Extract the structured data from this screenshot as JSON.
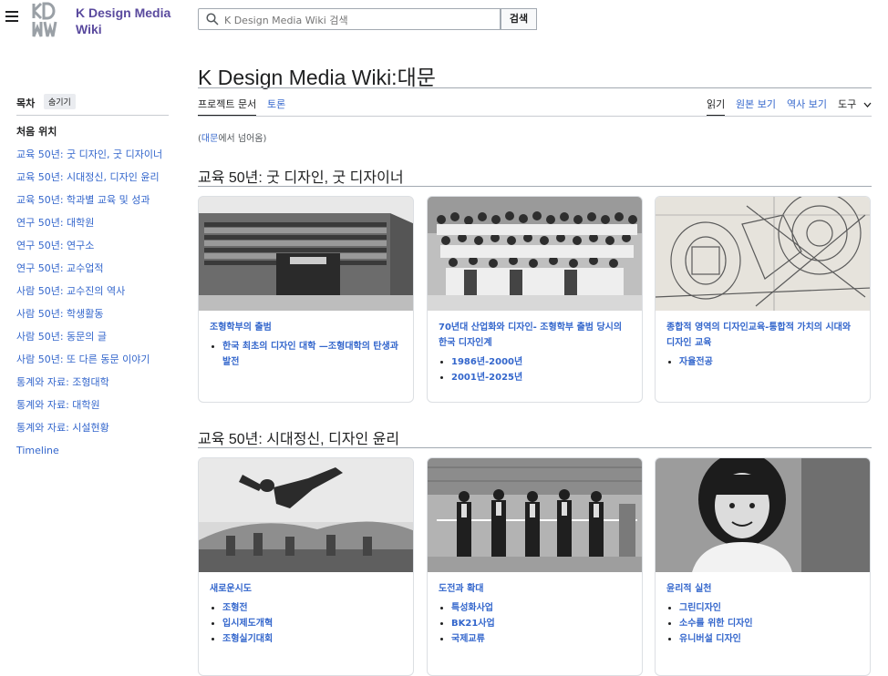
{
  "site": {
    "logo_mark": "KDMW",
    "name": "K Design Media Wiki"
  },
  "search": {
    "placeholder": "K Design Media Wiki 검색",
    "button": "검색"
  },
  "toc": {
    "title": "목차",
    "hide": "숨기기",
    "items": [
      "처음 위치",
      "교육 50년: 굿 디자인, 굿 디자이너",
      "교육 50년: 시대정신, 디자인 윤리",
      "교육 50년: 학과별 교육 및 성과",
      "연구 50년: 대학원",
      "연구 50년: 연구소",
      "연구 50년: 교수업적",
      "사람 50년: 교수진의 역사",
      "사람 50년: 학생활동",
      "사람 50년: 동문의 글",
      "사람 50년: 또 다른 동문 이야기",
      "통계와 자료: 조형대학",
      "통계와 자료: 대학원",
      "통계와 자료: 시설현황",
      "Timeline"
    ]
  },
  "page": {
    "title": "K Design Media Wiki:대문",
    "tabs": {
      "doc": "프로젝트 문서",
      "talk": "토론",
      "read": "읽기",
      "source": "원본 보기",
      "history": "역사 보기",
      "tools": "도구"
    },
    "redirect_link": "대문",
    "redirect_text": "에서 넘어옴"
  },
  "sections": [
    {
      "heading": "교육 50년: 굿 디자인, 굿 디자이너",
      "cards": [
        {
          "title": "조형학부의 출범",
          "items": [
            "한국 최초의 디자인 대학 —조형대학의 탄생과 발전"
          ]
        },
        {
          "title": "70년대 산업화와 디자인- 조형학부 출범 당시의 한국 디자인계",
          "items": [
            "1986년-2000년",
            "2001년-2025년"
          ]
        },
        {
          "title": "종합적 영역의 디자인교육-통합적 가치의 시대와 디자인 교육",
          "items": [
            "자율전공"
          ]
        }
      ]
    },
    {
      "heading": "교육 50년: 시대정신, 디자인 윤리",
      "cards": [
        {
          "title": "새로운시도",
          "items": [
            "조형전",
            "입시제도개혁",
            "조형실기대회"
          ]
        },
        {
          "title": "도전과 확대",
          "items": [
            "특성화사업",
            "BK21사업",
            "국제교류"
          ]
        },
        {
          "title": "윤리적 실천",
          "items": [
            "그린디자인",
            "소수를 위한 디자인",
            "유니버설 디자인"
          ]
        }
      ]
    }
  ]
}
